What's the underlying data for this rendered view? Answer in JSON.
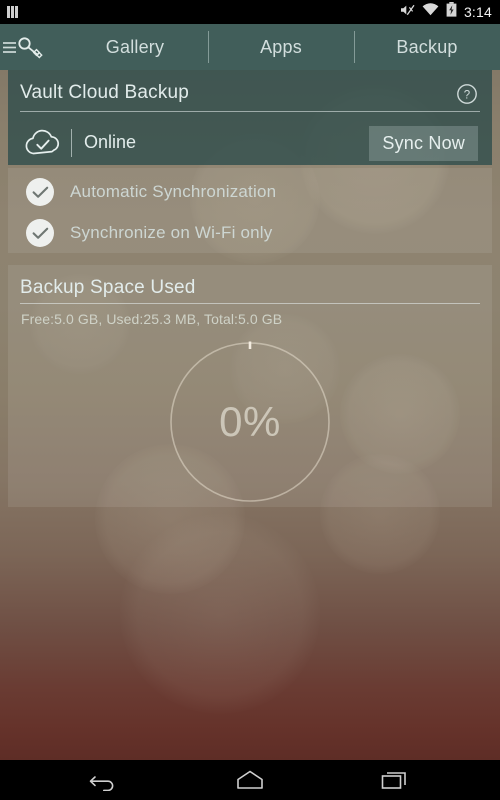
{
  "status_bar": {
    "sim_icon": "sim-card-icon",
    "mute_icon": "volume-muted-icon",
    "wifi_icon": "wifi-icon",
    "battery_icon": "battery-charging-icon",
    "time": "3:14"
  },
  "app_bar": {
    "logo_icon": "menu-key-logo-icon",
    "tabs": [
      {
        "label": "Gallery",
        "active": false
      },
      {
        "label": "Apps",
        "active": false
      },
      {
        "label": "Backup",
        "active": true
      }
    ],
    "background_color": "#3c5c59"
  },
  "cloud_card": {
    "title": "Vault Cloud Backup",
    "help_icon": "help-circle-icon",
    "status_icon": "cloud-check-icon",
    "status_text": "Online",
    "sync_button": "Sync Now"
  },
  "sync_options": [
    {
      "label": "Automatic Synchronization",
      "checked": true,
      "icon": "check-icon"
    },
    {
      "label": "Synchronize on Wi-Fi only",
      "checked": true,
      "icon": "check-icon"
    }
  ],
  "space_card": {
    "title": "Backup Space Used",
    "summary": "Free:5.0 GB, Used:25.3 MB, Total:5.0 GB",
    "free": "5.0 GB",
    "used": "25.3 MB",
    "total": "5.0 GB",
    "percent_label": "0%",
    "percent_value": 0
  },
  "nav_bar": {
    "back_icon": "back-arrow-icon",
    "home_icon": "home-icon",
    "recents_icon": "recent-apps-icon"
  }
}
